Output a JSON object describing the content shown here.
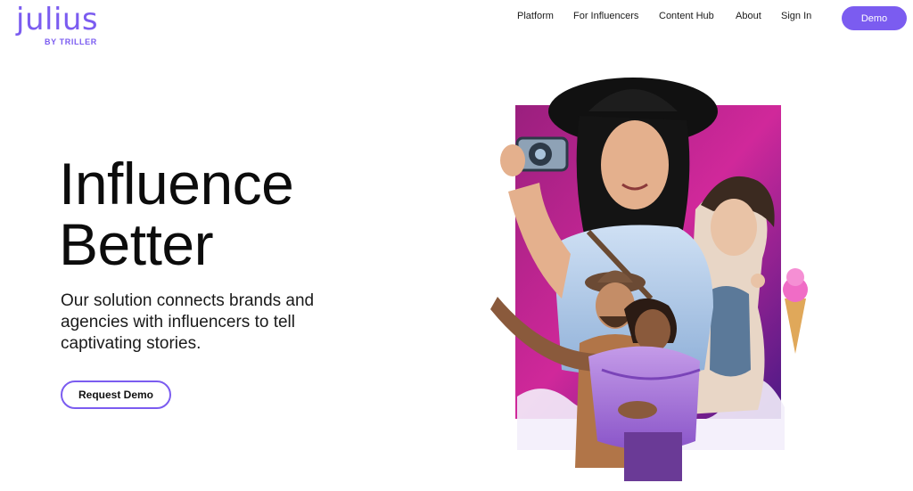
{
  "brand": {
    "name": "julius",
    "sub": "BY TRILLER",
    "color": "#7b5cf0"
  },
  "nav": {
    "items": [
      {
        "label": "Platform"
      },
      {
        "label": "For Influencers"
      },
      {
        "label": "Content Hub"
      },
      {
        "label": "About"
      },
      {
        "label": "Sign In"
      }
    ],
    "cta_label": "Demo"
  },
  "hero": {
    "title_line1": "Influence",
    "title_line2": "Better",
    "description": "Our solution connects brands and agencies with influencers to tell captivating stories.",
    "cta_label": "Request Demo"
  },
  "colors": {
    "accent": "#7b5cf0",
    "art_magenta": "#c0228f",
    "art_purple": "#5a1e8c"
  }
}
